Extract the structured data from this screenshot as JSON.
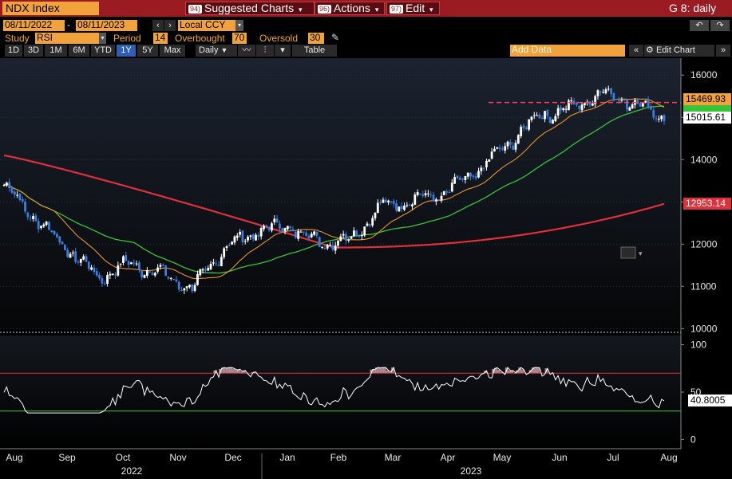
{
  "toolbar": {
    "ticker": "NDX Index",
    "suggested_badge": "94)",
    "suggested_label": "Suggested Charts",
    "actions_badge": "96)",
    "actions_label": "Actions",
    "edit_badge": "97)",
    "edit_label": "Edit",
    "right_label": "G 8: daily"
  },
  "range": {
    "start": "08/11/2022",
    "end": "08/11/2023",
    "currency": "Local CCY"
  },
  "study": {
    "study_label": "Study",
    "study_value": "RSI",
    "period_label": "Period",
    "period_value": "14",
    "overbought_label": "Overbought",
    "overbought_value": "70",
    "oversold_label": "Oversold",
    "oversold_value": "30"
  },
  "periods": [
    "1D",
    "3D",
    "1M",
    "6M",
    "YTD",
    "1Y",
    "5Y",
    "Max"
  ],
  "selected_period": "1Y",
  "frequency": "Daily",
  "table_label": "Table",
  "add_data_placeholder": "Add Data",
  "edit_chart_label": "Edit Chart",
  "colors": {
    "accent": "#f2a23a",
    "toolbar": "#9b1b22",
    "ma_short": "#e8932b",
    "ma_mid": "#38c438",
    "ma_long": "#e0303c",
    "candle_up": "#ffffff",
    "candle_down": "#3a7de0",
    "rsi_line": "#ffffff"
  },
  "chart_data": [
    {
      "type": "candlestick",
      "title": "NDX Index",
      "x_months": [
        "Aug",
        "Sep",
        "Oct",
        "Nov",
        "Dec",
        "Jan",
        "Feb",
        "Mar",
        "Apr",
        "May",
        "Jun",
        "Jul",
        "Aug"
      ],
      "years": [
        "2022",
        "2023"
      ],
      "y_ticks": [
        10000,
        11000,
        12000,
        13000,
        14000,
        15000,
        16000
      ],
      "ylim": [
        9950,
        16400
      ],
      "labels": {
        "ma_short": "15469.93",
        "last_price": "15015.61",
        "ma_long": "12953.14"
      },
      "reference_line": 15350,
      "close_monthly": [
        13400,
        12600,
        11900,
        11200,
        11550,
        11300,
        10950,
        11900,
        12300,
        12450,
        12050,
        12100,
        12900,
        13050,
        13200,
        13700,
        14350,
        15050,
        15200,
        15600,
        15350,
        15015
      ]
    },
    {
      "type": "line",
      "title": "RSI",
      "y_ticks": [
        0,
        50,
        100
      ],
      "ylim": [
        -3,
        108
      ],
      "overbought": 70,
      "oversold": 30,
      "last_value": "40.8005"
    }
  ]
}
